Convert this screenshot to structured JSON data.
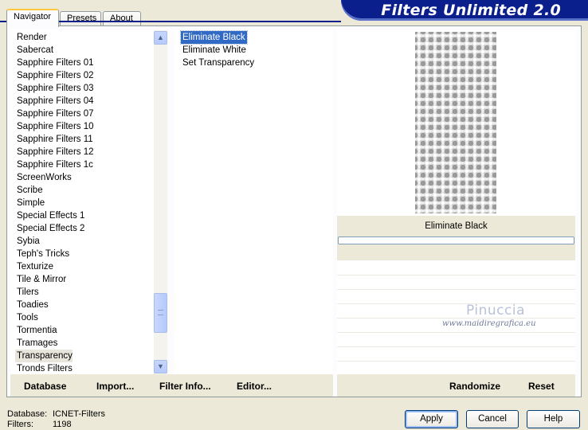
{
  "tabs": [
    {
      "label": "Navigator"
    },
    {
      "label": "Presets"
    },
    {
      "label": "About"
    }
  ],
  "banner": {
    "title": "Filters Unlimited 2.0"
  },
  "categories": [
    "Render",
    "Sabercat",
    "Sapphire Filters 01",
    "Sapphire Filters 02",
    "Sapphire Filters 03",
    "Sapphire Filters 04",
    "Sapphire Filters 07",
    "Sapphire Filters 10",
    "Sapphire Filters 11",
    "Sapphire Filters 12",
    "Sapphire Filters 1c",
    "ScreenWorks",
    "Scribe",
    "Simple",
    "Special Effects 1",
    "Special Effects 2",
    "Sybia",
    "Teph's Tricks",
    "Texturize",
    "Tile & Mirror",
    "Tilers",
    "Toadies",
    "Tools",
    "Tormentia",
    "Tramages",
    "Transparency",
    "Tronds Filters"
  ],
  "selected_category": "Transparency",
  "filters": [
    "Eliminate Black",
    "Eliminate White",
    "Set Transparency"
  ],
  "selected_filter": "Eliminate Black",
  "preview": {
    "caption": "Eliminate Black"
  },
  "watermark": {
    "name": "Pinuccia",
    "url": "www.maidiregrafica.eu"
  },
  "toolbar_left": {
    "database": "Database",
    "import": "Import...",
    "filter_info": "Filter Info...",
    "editor": "Editor..."
  },
  "toolbar_right": {
    "randomize": "Randomize",
    "reset": "Reset"
  },
  "status": {
    "database_label": "Database:",
    "database_value": "ICNET-Filters",
    "filters_label": "Filters:",
    "filters_value": "1198"
  },
  "dialog": {
    "apply": "Apply",
    "cancel": "Cancel",
    "help": "Help"
  },
  "colors": {
    "banner": "#0a1f8c",
    "selection": "#316ac5",
    "dialog_bg": "#ece9d8"
  },
  "icons": {
    "scroll_up": "chevron-up-icon",
    "scroll_down": "chevron-down-icon"
  }
}
